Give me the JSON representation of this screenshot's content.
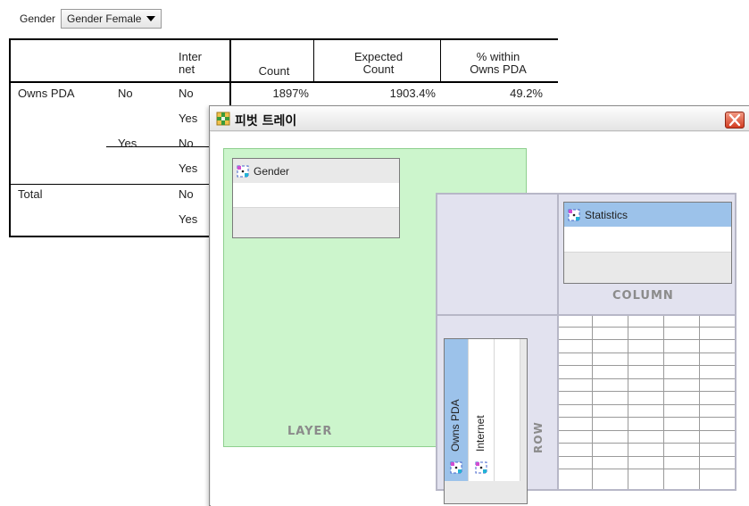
{
  "layer": {
    "label": "Gender",
    "selected": "Gender Female"
  },
  "table": {
    "headers": {
      "col3": "Inter\nnet",
      "count": "Count",
      "expected": "Expected\nCount",
      "within": "% within\nOwns PDA"
    },
    "row_group": "Owns PDA",
    "total": "Total",
    "sub_no": "No",
    "sub_yes": "Yes",
    "rows": [
      {
        "third": "No",
        "count": "1897%",
        "expected": "1903.4%",
        "within": "49.2%"
      },
      {
        "third": "Yes"
      },
      {
        "third": "No"
      },
      {
        "third": "Yes"
      },
      {
        "third": "No"
      },
      {
        "third": "Yes"
      }
    ]
  },
  "tray": {
    "title": "피벗 트레이",
    "zones": {
      "layer": "LAYER",
      "column": "COLUMN",
      "row": "ROW"
    },
    "fields": {
      "layer": "Gender",
      "column": "Statistics",
      "row1": "Owns PDA",
      "row2": "Internet"
    }
  },
  "colors": {
    "layer_zone": "#ccf5cc",
    "selected_field": "#9cc2ea",
    "close_button": "#d23d22"
  }
}
